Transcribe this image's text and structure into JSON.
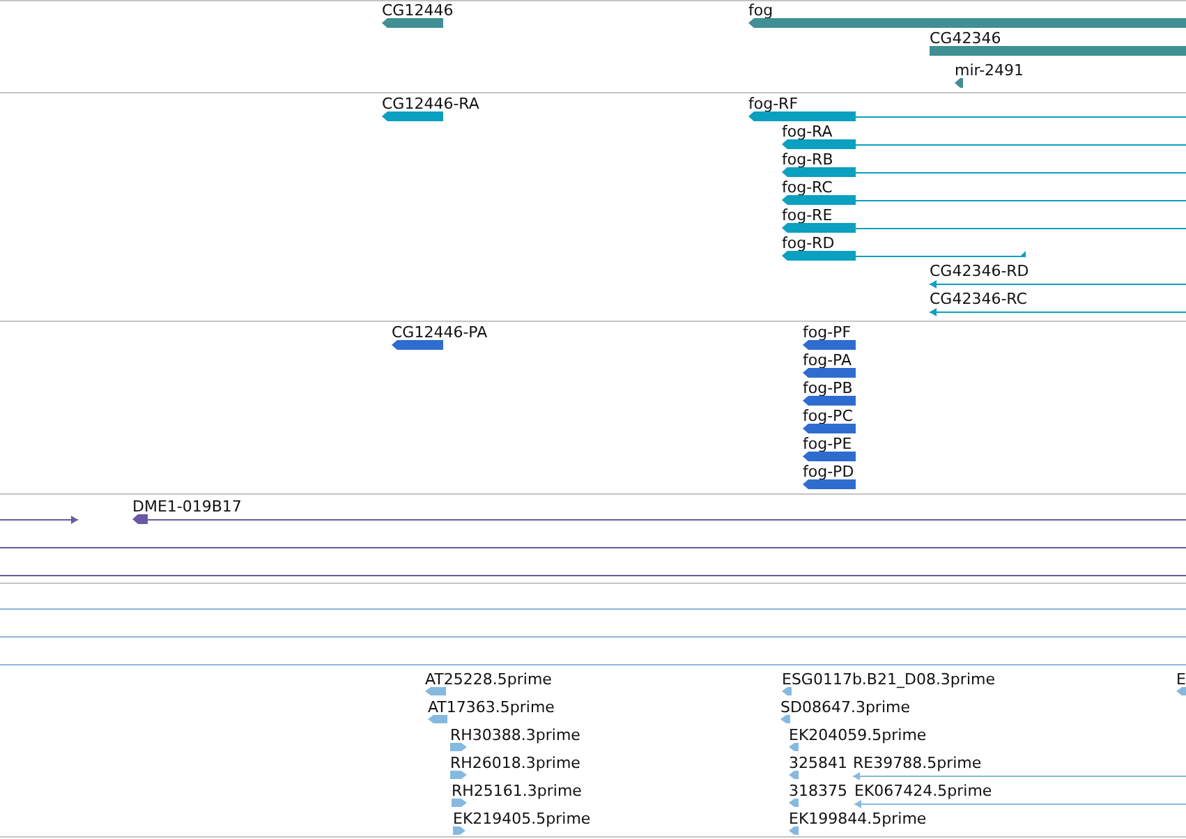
{
  "tracks": [
    {
      "kind": "gene",
      "color": "#3f8f94",
      "features": [
        {
          "label": "CG12446",
          "arrow": true,
          "reverse": true
        },
        {
          "label": "fog",
          "arrow": true,
          "reverse": true
        },
        {
          "label": "CG42346",
          "arrow": false
        },
        {
          "label": "mir-2491",
          "arrow": true,
          "reverse": true
        }
      ]
    },
    {
      "kind": "transcript",
      "color": "#0aa0c0",
      "features": [
        {
          "label": "CG12446-RA",
          "arrow": true,
          "reverse": true
        },
        {
          "label": "fog-RF",
          "arrow": true,
          "reverse": true
        },
        {
          "label": "fog-RA",
          "arrow": true,
          "reverse": true
        },
        {
          "label": "fog-RB",
          "arrow": true,
          "reverse": true
        },
        {
          "label": "fog-RC",
          "arrow": true,
          "reverse": true
        },
        {
          "label": "fog-RE",
          "arrow": true,
          "reverse": true
        },
        {
          "label": "fog-RD",
          "arrow": true,
          "reverse": true
        },
        {
          "label": "CG42346-RD",
          "arrow": true,
          "reverse": true
        },
        {
          "label": "CG42346-RC",
          "arrow": true,
          "reverse": true
        }
      ]
    },
    {
      "kind": "protein",
      "color": "#2f6ccf",
      "features": [
        {
          "label": "CG12446-PA",
          "arrow": true,
          "reverse": true
        },
        {
          "label": "fog-PF",
          "arrow": true,
          "reverse": true
        },
        {
          "label": "fog-PA",
          "arrow": true,
          "reverse": true
        },
        {
          "label": "fog-PB",
          "arrow": true,
          "reverse": true
        },
        {
          "label": "fog-PC",
          "arrow": true,
          "reverse": true
        },
        {
          "label": "fog-PE",
          "arrow": true,
          "reverse": true
        },
        {
          "label": "fog-PD",
          "arrow": true,
          "reverse": true
        }
      ]
    },
    {
      "kind": "clone",
      "color": "#6b58a4",
      "features": [
        {
          "arrow": true,
          "reverse": false
        },
        {
          "label": "DME1-019B17",
          "arrow": true,
          "reverse": true
        },
        {
          "arrow": false
        },
        {
          "arrow": false
        }
      ]
    },
    {
      "kind": "cdna",
      "color": "#8ab8dc",
      "features": [
        {
          "arrow": false
        },
        {
          "arrow": false
        },
        {
          "arrow": false
        }
      ]
    },
    {
      "kind": "est",
      "color": "#86b9e0",
      "features": [
        {
          "label": "AT25228.5prime",
          "arrow": true,
          "reverse": true
        },
        {
          "label": "AT17363.5prime",
          "arrow": true,
          "reverse": true
        },
        {
          "label": "RH30388.3prime",
          "arrow": true,
          "reverse": false
        },
        {
          "label": "RH26018.3prime",
          "arrow": true,
          "reverse": false
        },
        {
          "label": "RH25161.3prime",
          "arrow": true,
          "reverse": false
        },
        {
          "label": "EK219405.5prime",
          "arrow": true,
          "reverse": false
        },
        {
          "label": "ESG0117b.B21_D08.3prime",
          "arrow": true,
          "reverse": true
        },
        {
          "label": "SD08647.3prime",
          "arrow": true,
          "reverse": true
        },
        {
          "label": "EK204059.5prime",
          "arrow": true,
          "reverse": true
        },
        {
          "label": "325841",
          "arrow": true,
          "reverse": true
        },
        {
          "label": "RE39788.5prime",
          "arrow": true,
          "reverse": true
        },
        {
          "label": "318375",
          "arrow": true,
          "reverse": true
        },
        {
          "label": "EK067424.5prime",
          "arrow": true,
          "reverse": true
        },
        {
          "label": "EK199844.5prime",
          "arrow": true,
          "reverse": true
        },
        {
          "label": "E",
          "arrow": true,
          "reverse": true
        }
      ]
    }
  ]
}
